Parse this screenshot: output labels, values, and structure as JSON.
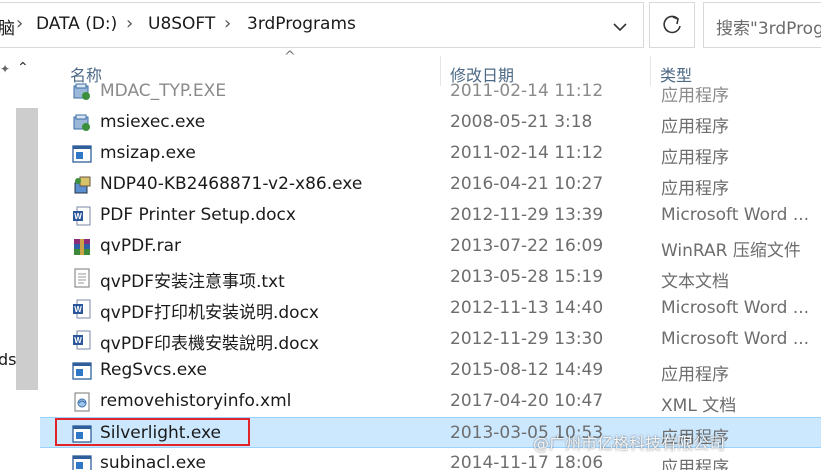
{
  "breadcrumb": {
    "partial_prev": "脑",
    "items": [
      "DATA (D:)",
      "U8SOFT",
      "3rdPrograms"
    ]
  },
  "search": {
    "placeholder": "搜索\"3rdProg"
  },
  "nav": {
    "partial_text": "ds"
  },
  "columns": {
    "name": "名称",
    "date": "修改日期",
    "type": "类型"
  },
  "files": [
    {
      "name": "MDAC_TYP.EXE",
      "date": "2011-02-14 11:12",
      "type": "应用程序",
      "icon": "installer-icon",
      "cut": true
    },
    {
      "name": "msiexec.exe",
      "date": "2008-05-21 3:18",
      "type": "应用程序",
      "icon": "installer-icon"
    },
    {
      "name": "msizap.exe",
      "date": "2011-02-14 11:12",
      "type": "应用程序",
      "icon": "exe-window-icon"
    },
    {
      "name": "NDP40-KB2468871-v2-x86.exe",
      "date": "2016-04-21 10:27",
      "type": "应用程序",
      "icon": "setup-package-icon"
    },
    {
      "name": "PDF Printer Setup.docx",
      "date": "2012-11-29 13:39",
      "type": "Microsoft Word ...",
      "icon": "word-doc-icon"
    },
    {
      "name": "qvPDF.rar",
      "date": "2013-07-22 16:09",
      "type": "WinRAR 压缩文件",
      "icon": "winrar-archive-icon"
    },
    {
      "name": "qvPDF安装注意事项.txt",
      "date": "2013-05-28 15:19",
      "type": "文本文档",
      "icon": "text-file-icon"
    },
    {
      "name": "qvPDF打印机安装说明.docx",
      "date": "2012-11-13 14:40",
      "type": "Microsoft Word ...",
      "icon": "word-doc-icon"
    },
    {
      "name": "qvPDF印表機安裝說明.docx",
      "date": "2012-11-29 13:30",
      "type": "Microsoft Word ...",
      "icon": "word-doc-icon"
    },
    {
      "name": "RegSvcs.exe",
      "date": "2015-08-12 14:49",
      "type": "应用程序",
      "icon": "exe-window-icon"
    },
    {
      "name": "removehistoryinfo.xml",
      "date": "2017-04-20 10:47",
      "type": "XML 文档",
      "icon": "xml-file-icon"
    },
    {
      "name": "Silverlight.exe",
      "date": "2013-03-05 10:53",
      "type": "应用程序",
      "icon": "exe-window-icon",
      "selected": true
    },
    {
      "name": "subinacl.exe",
      "date": "2014-11-17 18:06",
      "type": "应用程序",
      "icon": "exe-window-icon"
    }
  ],
  "watermark": "@广州市亿格科技有限公司"
}
